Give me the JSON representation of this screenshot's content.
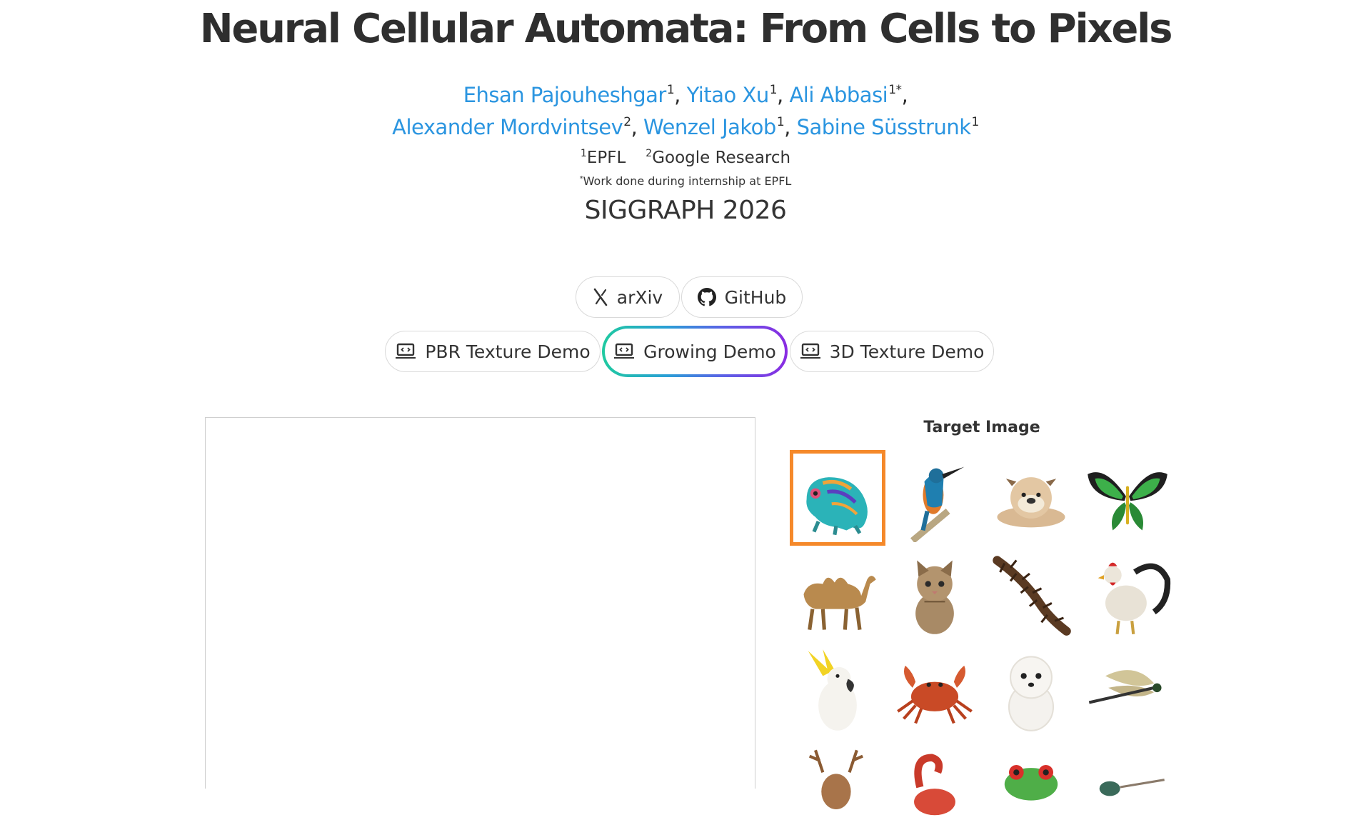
{
  "page": {
    "title": "Neural Cellular Automata: From Cells to Pixels",
    "authors_line1": [
      {
        "name": "Ehsan Pajouheshgar",
        "sup": "1",
        "sep": ","
      },
      {
        "name": "Yitao Xu",
        "sup": "1",
        "sep": ","
      },
      {
        "name": "Ali Abbasi",
        "sup": "1*",
        "sep": ","
      }
    ],
    "authors_line2": [
      {
        "name": "Alexander Mordvintsev",
        "sup": "2",
        "sep": ","
      },
      {
        "name": "Wenzel Jakob",
        "sup": "1",
        "sep": ","
      },
      {
        "name": "Sabine Süsstrunk",
        "sup": "1",
        "sep": ""
      }
    ],
    "affiliations": [
      {
        "sup": "1",
        "name": "EPFL"
      },
      {
        "sup": "2",
        "name": "Google Research"
      }
    ],
    "note_sup": "*",
    "note": "Work done during internship at EPFL",
    "venue": "SIGGRAPH 2026"
  },
  "links": {
    "arxiv": {
      "label": "arXiv",
      "icon": "arxiv-icon"
    },
    "github": {
      "label": "GitHub",
      "icon": "github-icon"
    },
    "pbr": {
      "label": "PBR Texture Demo",
      "icon": "laptop-code-icon"
    },
    "growing": {
      "label": "Growing Demo",
      "icon": "laptop-code-icon",
      "active": true
    },
    "texture3d": {
      "label": "3D Texture Demo",
      "icon": "laptop-code-icon"
    }
  },
  "target_panel": {
    "title": "Target Image",
    "selected": "chameleon",
    "images": [
      "chameleon",
      "kingfisher",
      "bulldog",
      "butterfly",
      "camel",
      "kitten",
      "centipede",
      "rooster",
      "cockatoo",
      "crab",
      "pomeranian",
      "dragonfly",
      "deer",
      "flamingo",
      "tree-frog",
      "bird"
    ]
  },
  "colors": {
    "link": "#2b95e0",
    "selected_border": "#f5892a",
    "active_gradient": [
      "#1fcaa0",
      "#2a9fd6",
      "#5b62e6",
      "#8a2be2"
    ]
  }
}
